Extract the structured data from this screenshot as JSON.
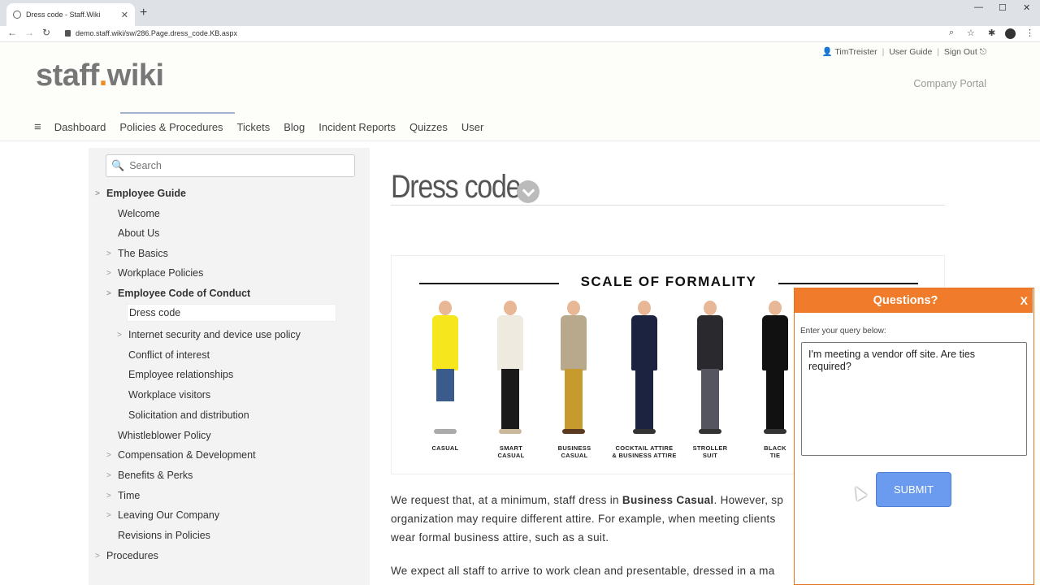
{
  "browser": {
    "tab_title": "Dress code - Staff.Wiki",
    "tab_close": "✕",
    "new_tab": "+",
    "url": "demo.staff.wiki/sw/286.Page.dress_code.KB.aspx",
    "back": "←",
    "forward": "→",
    "reload": "↻",
    "window_min": "—",
    "window_max": "☐",
    "window_close": "✕",
    "zoom": "⌕",
    "star": "☆",
    "extensions": "✱",
    "menu": "⋮"
  },
  "header": {
    "logo_part1": "staff",
    "logo_dot": ".",
    "logo_part2": "wiki",
    "user_name": "TimTreister",
    "user_guide": "User Guide",
    "sign_out": "Sign Out",
    "separator": "|",
    "company_portal": "Company Portal",
    "menu_icon": "≡",
    "nav": [
      "Dashboard",
      "Policies & Procedures",
      "Tickets",
      "Blog",
      "Incident Reports",
      "Quizzes",
      "User"
    ]
  },
  "sidebar": {
    "search_placeholder": "Search",
    "search_icon": "🔍",
    "items": [
      {
        "label": "Employee Guide",
        "chev": ">"
      },
      {
        "label": "Welcome"
      },
      {
        "label": "About Us"
      },
      {
        "label": "The Basics",
        "chev": ">"
      },
      {
        "label": "Workplace Policies",
        "chev": ">"
      },
      {
        "label": "Employee Code of Conduct",
        "chev": ">"
      },
      {
        "label": "Dress code"
      },
      {
        "label": "Internet security and device use policy",
        "chev": ">"
      },
      {
        "label": "Conflict of interest"
      },
      {
        "label": "Employee relationships"
      },
      {
        "label": "Workplace visitors"
      },
      {
        "label": "Solicitation and distribution"
      },
      {
        "label": "Whistleblower Policy"
      },
      {
        "label": "Compensation & Development",
        "chev": ">"
      },
      {
        "label": "Benefits & Perks",
        "chev": ">"
      },
      {
        "label": "Time",
        "chev": ">"
      },
      {
        "label": "Leaving Our Company",
        "chev": ">"
      },
      {
        "label": "Revisions in Policies"
      },
      {
        "label": "Procedures",
        "chev": ">"
      }
    ]
  },
  "page": {
    "title": "Dress code",
    "figure_title": "SCALE OF FORMALITY",
    "formality_levels": [
      {
        "line1": "CASUAL",
        "line2": ""
      },
      {
        "line1": "SMART",
        "line2": "CASUAL"
      },
      {
        "line1": "BUSINESS",
        "line2": "CASUAL"
      },
      {
        "line1": "COCKTAIL ATTIRE",
        "line2": "& BUSINESS ATTIRE"
      },
      {
        "line1": "STROLLER",
        "line2": "SUIT"
      },
      {
        "line1": "BLACK",
        "line2": "TIE"
      }
    ],
    "para1_a": "We request that, at a minimum, staff dress in ",
    "para1_bold": "Business Casual",
    "para1_b": ". However, sp",
    "para1_line2": "organization may require different attire. For example, when meeting clients",
    "para1_line3": "wear formal business attire, such as a suit.",
    "para2": "We expect all staff to arrive to work clean and presentable, dressed in a ma"
  },
  "questions": {
    "title": "Questions?",
    "close": "X",
    "label": "Enter your query below:",
    "query": "I'm meeting a vendor off site. Are ties required?",
    "submit": "SUBMIT"
  },
  "colors": {
    "accent_orange": "#f07b2a",
    "submit_blue": "#6b9bef"
  }
}
